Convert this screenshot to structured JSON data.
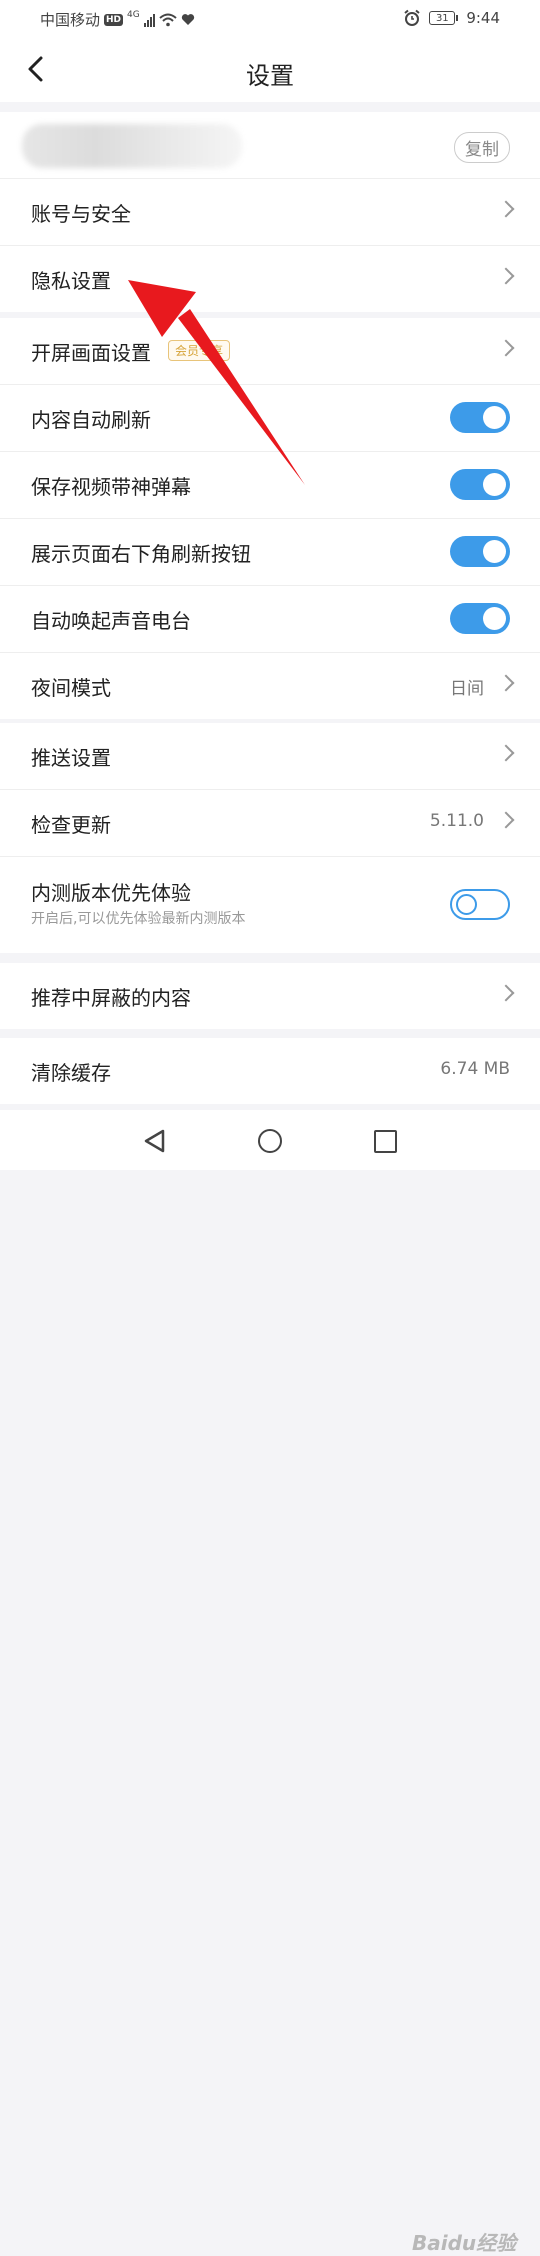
{
  "status_bar": {
    "carrier": "中国移动",
    "hd": "HD",
    "network": "4G",
    "battery": "31",
    "time": "9:44"
  },
  "header": {
    "title": "设置"
  },
  "account": {
    "copy_label": "复制"
  },
  "group1": [
    {
      "label": "账号与安全"
    },
    {
      "label": "隐私设置"
    }
  ],
  "group2": {
    "splash": {
      "label": "开屏画面设置",
      "badge": "会员专享"
    },
    "auto_refresh": {
      "label": "内容自动刷新",
      "on": true
    },
    "save_danmaku": {
      "label": "保存视频带神弹幕",
      "on": true
    },
    "refresh_button": {
      "label": "展示页面右下角刷新按钮",
      "on": true
    },
    "radio": {
      "label": "自动唤起声音电台",
      "on": true
    },
    "night_mode": {
      "label": "夜间模式",
      "value": "日间"
    }
  },
  "group3": {
    "push": {
      "label": "推送设置"
    },
    "update": {
      "label": "检查更新",
      "value": "5.11.0"
    },
    "beta": {
      "label": "内测版本优先体验",
      "subtext": "开启后,可以优先体验最新内测版本",
      "on": false
    }
  },
  "group4": {
    "blocked": {
      "label": "推荐中屏蔽的内容"
    }
  },
  "group5": {
    "cache": {
      "label": "清除缓存",
      "value": "6.74 MB"
    }
  },
  "watermark": "Baidu经验",
  "colors": {
    "accent": "#3d9be9",
    "arrow": "#e8191e",
    "badge": "#d6a43a"
  }
}
